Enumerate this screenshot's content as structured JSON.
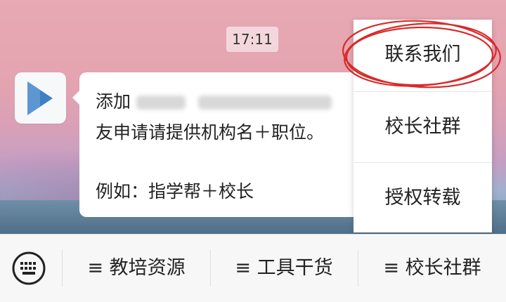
{
  "status": {
    "time": "17:11"
  },
  "chat": {
    "avatar_icon": "play-triangle-logo-icon",
    "message": {
      "line1_prefix": "添加",
      "line2": "友申请请提供机构名＋职位。",
      "line3": "例如：指学帮＋校长"
    }
  },
  "menu": {
    "items": [
      {
        "label": "联系我们"
      },
      {
        "label": "校长社群"
      },
      {
        "label": "授权转载"
      }
    ]
  },
  "bottom_bar": {
    "keyboard_icon": "keyboard-icon",
    "tabs": [
      {
        "label": "≡ 教培资源"
      },
      {
        "label": "≡ 工具干货"
      },
      {
        "label": "≡ 校长社群"
      }
    ]
  },
  "colors": {
    "scribble": "#d82a2a",
    "logo_blue": "#3f7fc2"
  }
}
